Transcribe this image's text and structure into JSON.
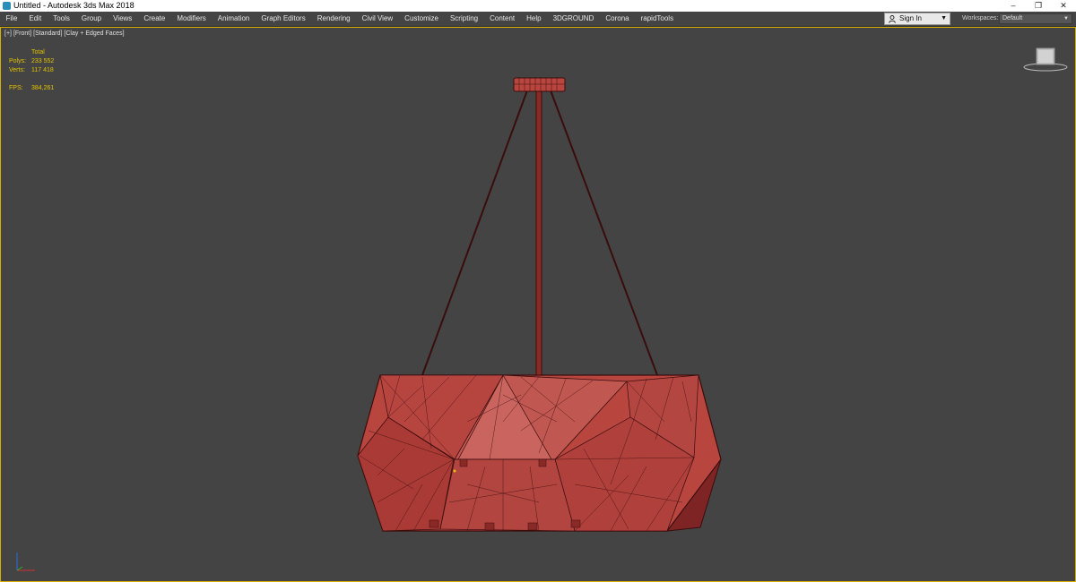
{
  "window": {
    "title": "Untitled - Autodesk 3ds Max 2018",
    "controls": {
      "minimize": "–",
      "restore": "❐",
      "close": "✕"
    }
  },
  "menu": [
    "File",
    "Edit",
    "Tools",
    "Group",
    "Views",
    "Create",
    "Modifiers",
    "Animation",
    "Graph Editors",
    "Rendering",
    "Civil View",
    "Customize",
    "Scripting",
    "Content",
    "Help",
    "3DGROUND",
    "Corona",
    "rapidTools"
  ],
  "account": {
    "signin_label": "Sign In"
  },
  "workspaces": {
    "label": "Workspaces:",
    "value": "Default"
  },
  "viewport": {
    "labels": [
      "[+]",
      "[Front]",
      "[Standard]",
      "[Clay + Edged Faces]"
    ],
    "stats": {
      "header": "Total",
      "polys_label": "Polys:",
      "polys_value": "233 552",
      "verts_label": "Verts:",
      "verts_value": "117 418",
      "fps_label": "FPS:",
      "fps_value": "384,261"
    }
  },
  "colors": {
    "viewport_bg": "#444444",
    "active_border": "#d8b000",
    "stats_text": "#e3c300",
    "clay": "#b8453e",
    "wire": "#3a0d0d"
  },
  "icons": {
    "app": "3dsmax-app-icon",
    "user": "user-icon",
    "viewcube": "viewcube-icon",
    "axis": "axis-tripod-icon"
  }
}
